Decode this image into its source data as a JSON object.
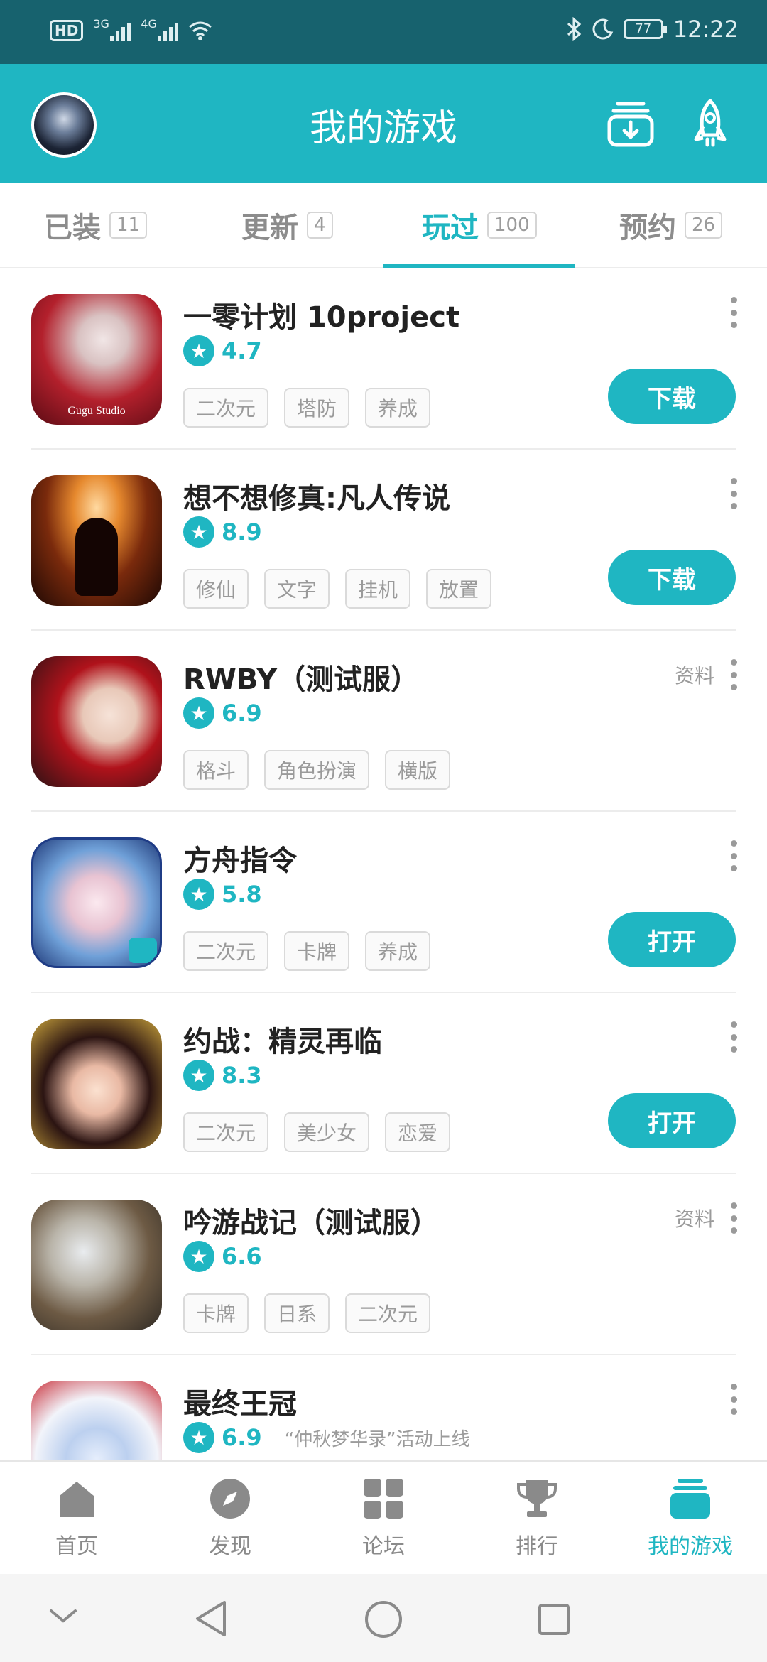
{
  "status_bar": {
    "hd": "HD",
    "sig1": "3G",
    "sig2": "4G",
    "battery": "77",
    "time": "12:22"
  },
  "header": {
    "title": "我的游戏"
  },
  "tabs": [
    {
      "label": "已装",
      "count": "11"
    },
    {
      "label": "更新",
      "count": "4"
    },
    {
      "label": "玩过",
      "count": "100"
    },
    {
      "label": "预约",
      "count": "26"
    }
  ],
  "games": [
    {
      "name": "一零计划 10project",
      "rating": "4.7",
      "tags": [
        "二次元",
        "塔防",
        "养成"
      ],
      "action": "下载",
      "info": ""
    },
    {
      "name": "想不想修真:凡人传说",
      "rating": "8.9",
      "tags": [
        "修仙",
        "文字",
        "挂机",
        "放置"
      ],
      "action": "下载",
      "info": ""
    },
    {
      "name": "RWBY（测试服）",
      "rating": "6.9",
      "tags": [
        "格斗",
        "角色扮演",
        "横版"
      ],
      "action": "",
      "info": "资料"
    },
    {
      "name": "方舟指令",
      "rating": "5.8",
      "tags": [
        "二次元",
        "卡牌",
        "养成"
      ],
      "action": "打开",
      "info": ""
    },
    {
      "name": "约战：精灵再临",
      "rating": "8.3",
      "tags": [
        "二次元",
        "美少女",
        "恋爱"
      ],
      "action": "打开",
      "info": ""
    },
    {
      "name": "吟游战记（测试服）",
      "rating": "6.6",
      "tags": [
        "卡牌",
        "日系",
        "二次元"
      ],
      "action": "",
      "info": "资料"
    },
    {
      "name": "最终王冠",
      "rating": "6.9",
      "note": "“仲秋梦华录”活动上线",
      "tags": [],
      "action": "",
      "info": ""
    }
  ],
  "bottom_nav": [
    {
      "label": "首页",
      "icon": "home-icon"
    },
    {
      "label": "发现",
      "icon": "compass-icon"
    },
    {
      "label": "论坛",
      "icon": "grid-icon"
    },
    {
      "label": "排行",
      "icon": "trophy-icon"
    },
    {
      "label": "我的游戏",
      "icon": "stack-icon"
    }
  ],
  "colors": {
    "accent": "#1fb6c2",
    "status_bar": "#17626e"
  }
}
